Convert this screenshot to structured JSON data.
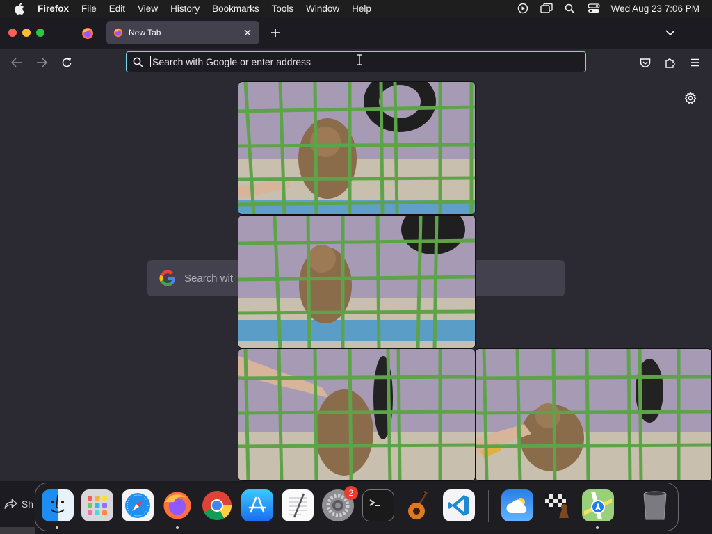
{
  "menubar": {
    "app_name": "Firefox",
    "items": [
      "File",
      "Edit",
      "View",
      "History",
      "Bookmarks",
      "Tools",
      "Window",
      "Help"
    ],
    "clock": "Wed Aug 23  7:06 PM",
    "status_icons": [
      "screen-record-icon",
      "screen-mirroring-icon",
      "spotlight-icon",
      "control-center-icon"
    ]
  },
  "tabs": {
    "active_title": "New Tab"
  },
  "urlbar": {
    "placeholder": "Search with Google or enter address"
  },
  "newtab": {
    "search_placeholder": "Search wit"
  },
  "dock": {
    "share_label": "Sh",
    "badge_count": "2",
    "apps": [
      "Finder",
      "Launchpad",
      "Safari",
      "Firefox",
      "Chrome",
      "App Store",
      "TextEdit",
      "System Settings",
      "Terminal",
      "GarageBand",
      "Visual Studio Code",
      "Weather",
      "Chess",
      "Maps",
      "Trash"
    ]
  },
  "colors": {
    "accent_focus": "#7ed3ee",
    "toolbar": "#2b2a33",
    "tabstrip": "#1c1b22"
  }
}
